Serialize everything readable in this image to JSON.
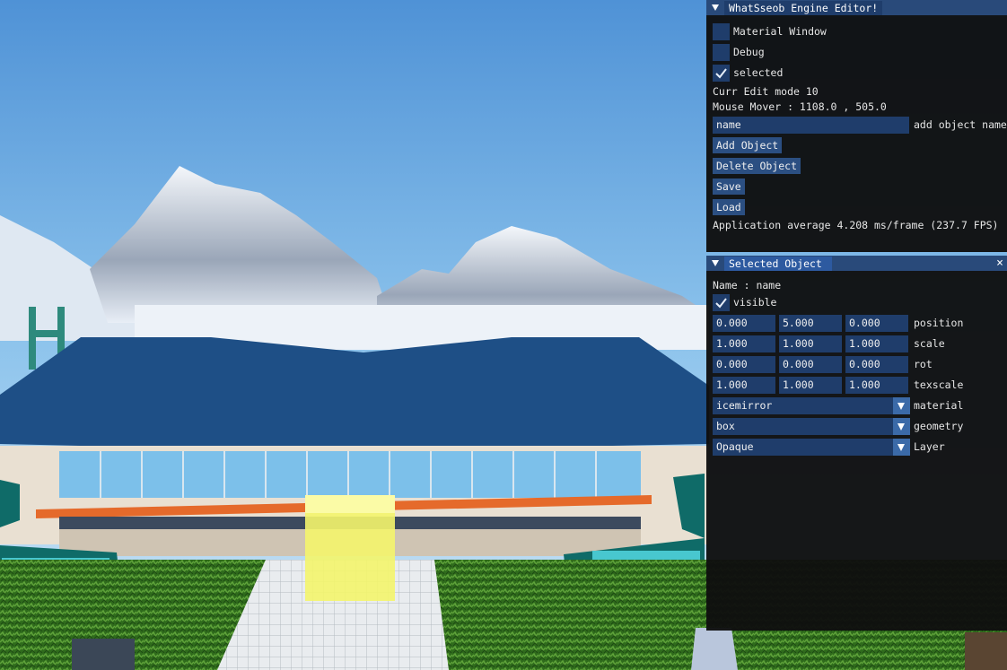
{
  "editor": {
    "title": "WhatSseob Engine Editor!",
    "material_window": "Material Window",
    "debug": "Debug",
    "selected": "selected",
    "edit_mode": "Curr Edit mode 10",
    "mouse_mover": "Mouse Mover : 1108.0 , 505.0",
    "name_value": "name",
    "name_label": "add object name",
    "add_object": "Add Object",
    "delete_object": "Delete Object",
    "save": "Save",
    "load": "Load",
    "fps_text": "Application average 4.208 ms/frame (237.7 FPS)"
  },
  "selected_panel": {
    "title": "Selected Object",
    "close": "×",
    "name_line": "Name : name",
    "visible": "visible",
    "position": {
      "x": "0.000",
      "y": "5.000",
      "z": "0.000",
      "label": "position"
    },
    "scale": {
      "x": "1.000",
      "y": "1.000",
      "z": "1.000",
      "label": "scale"
    },
    "rot": {
      "x": "0.000",
      "y": "0.000",
      "z": "0.000",
      "label": "rot"
    },
    "texscale": {
      "x": "1.000",
      "y": "1.000",
      "z": "1.000",
      "label": "texscale"
    },
    "material": {
      "value": "icemirror",
      "label": "material"
    },
    "geometry": {
      "value": "box",
      "label": "geometry"
    },
    "layer": {
      "value": "Opaque",
      "label": "Layer"
    }
  },
  "colors": {
    "accent": "#294a7a",
    "field": "#1f3d6b",
    "button": "#2b4f82"
  }
}
